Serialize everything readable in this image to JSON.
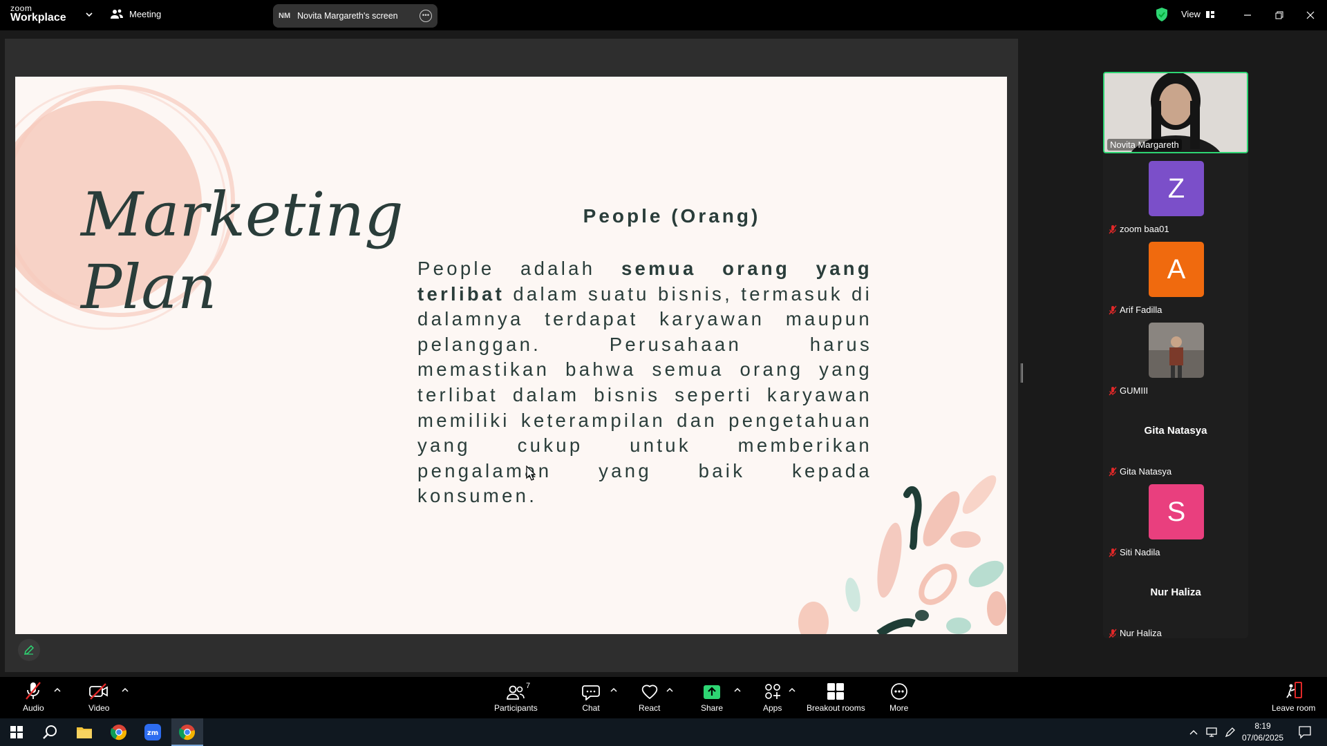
{
  "titlebar": {
    "logo_top": "zoom",
    "logo_bottom": "Workplace",
    "meeting_label": "Meeting",
    "share_initials": "NM",
    "share_label": "Novita Margareth's screen",
    "view_label": "View"
  },
  "slide": {
    "script_line1": "Marketing",
    "script_line2": "Plan",
    "title": "People (Orang)",
    "body_start": "People adalah ",
    "body_bold": "semua orang yang terlibat",
    "body_rest": " dalam suatu bisnis, termasuk di dalamnya terdapat karyawan maupun pelanggan. Perusahaan harus memastikan bahwa semua orang yang terlibat dalam bisnis seperti karyawan memiliki keterampilan dan pengetahuan yang cukup untuk memberikan pengalaman yang baik kepada konsumen."
  },
  "gallery": {
    "active_speaker": "Novita Margareth",
    "participants": [
      {
        "name": "zoom baa01",
        "initial": "Z",
        "color": "#7b4fc9",
        "type": "avatar"
      },
      {
        "name": "Arif Fadilla",
        "initial": "A",
        "color": "#f06a0e",
        "type": "avatar"
      },
      {
        "name": "GUMIII",
        "type": "photo"
      },
      {
        "name": "Gita Natasya",
        "display": "Gita Natasya",
        "type": "name"
      },
      {
        "name": "Siti Nadila",
        "initial": "S",
        "color": "#e93f7e",
        "type": "avatar"
      },
      {
        "name": "Nur Haliza",
        "display": "Nur Haliza",
        "type": "name"
      }
    ]
  },
  "toolbar": {
    "audio": "Audio",
    "video": "Video",
    "participants": "Participants",
    "participants_count": "7",
    "chat": "Chat",
    "react": "React",
    "share": "Share",
    "apps": "Apps",
    "breakout": "Breakout rooms",
    "more": "More",
    "leave": "Leave room",
    "share_color": "#2ed573"
  },
  "taskbar": {
    "time": "8:19",
    "date": "07/06/2025"
  }
}
